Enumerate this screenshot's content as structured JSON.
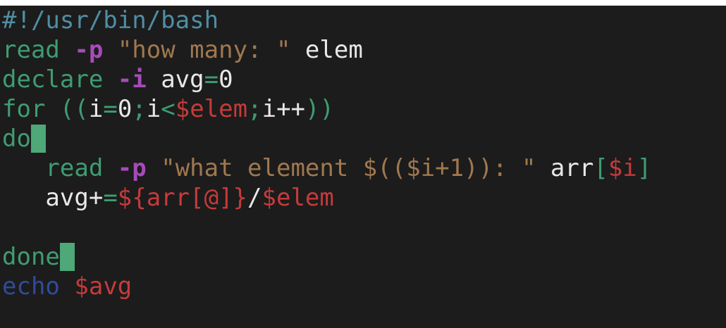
{
  "colors": {
    "background": "#1c1c1c",
    "comment": "#4f8ea3",
    "keyword": "#3f9c72",
    "flag": "#a64bb9",
    "string": "#a0784f",
    "variable": "#c73a3a",
    "plain": "#e8e8e8",
    "echo": "#2f4c9b",
    "cursor": "#4ea878"
  },
  "editor": {
    "lines": [
      {
        "indent": 0,
        "tokens": [
          {
            "text": "#!/usr/bin/bash",
            "color": "comment"
          }
        ]
      },
      {
        "indent": 0,
        "tokens": [
          {
            "text": "read",
            "color": "keyword"
          },
          {
            "text": " ",
            "color": "plain"
          },
          {
            "text": "-p",
            "color": "flag",
            "bold": true
          },
          {
            "text": " ",
            "color": "plain"
          },
          {
            "text": "\"how many: \"",
            "color": "string"
          },
          {
            "text": " elem",
            "color": "plain"
          }
        ]
      },
      {
        "indent": 0,
        "tokens": [
          {
            "text": "declare",
            "color": "keyword"
          },
          {
            "text": " ",
            "color": "plain"
          },
          {
            "text": "-i",
            "color": "flag",
            "bold": true
          },
          {
            "text": " avg",
            "color": "plain"
          },
          {
            "text": "=",
            "color": "keyword"
          },
          {
            "text": "0",
            "color": "plain"
          }
        ]
      },
      {
        "indent": 0,
        "tokens": [
          {
            "text": "for",
            "color": "keyword"
          },
          {
            "text": " ((",
            "color": "keyword"
          },
          {
            "text": "i",
            "color": "plain"
          },
          {
            "text": "=",
            "color": "keyword"
          },
          {
            "text": "0",
            "color": "plain"
          },
          {
            "text": ";",
            "color": "keyword"
          },
          {
            "text": "i",
            "color": "plain"
          },
          {
            "text": "<",
            "color": "keyword"
          },
          {
            "text": "$elem",
            "color": "variable"
          },
          {
            "text": ";",
            "color": "keyword"
          },
          {
            "text": "i++",
            "color": "plain"
          },
          {
            "text": "))",
            "color": "keyword"
          }
        ]
      },
      {
        "indent": 0,
        "cursor": true,
        "tokens": [
          {
            "text": "do",
            "color": "keyword"
          }
        ]
      },
      {
        "indent": 3,
        "tokens": [
          {
            "text": "read",
            "color": "keyword"
          },
          {
            "text": " ",
            "color": "plain"
          },
          {
            "text": "-p",
            "color": "flag",
            "bold": true
          },
          {
            "text": " ",
            "color": "plain"
          },
          {
            "text": "\"what element $(($i+1)): \"",
            "color": "string"
          },
          {
            "text": " arr",
            "color": "plain"
          },
          {
            "text": "[",
            "color": "keyword"
          },
          {
            "text": "$i",
            "color": "variable"
          },
          {
            "text": "]",
            "color": "keyword"
          }
        ]
      },
      {
        "indent": 3,
        "tokens": [
          {
            "text": "avg+",
            "color": "plain"
          },
          {
            "text": "=",
            "color": "keyword"
          },
          {
            "text": "${arr[@]}",
            "color": "variable"
          },
          {
            "text": "/",
            "color": "plain"
          },
          {
            "text": "$elem",
            "color": "variable"
          }
        ]
      },
      {
        "indent": 0,
        "tokens": []
      },
      {
        "indent": 0,
        "cursor": true,
        "tokens": [
          {
            "text": "done",
            "color": "keyword"
          }
        ]
      },
      {
        "indent": 0,
        "tokens": [
          {
            "text": "echo",
            "color": "echo"
          },
          {
            "text": " ",
            "color": "plain"
          },
          {
            "text": "$avg",
            "color": "variable"
          }
        ]
      }
    ]
  }
}
